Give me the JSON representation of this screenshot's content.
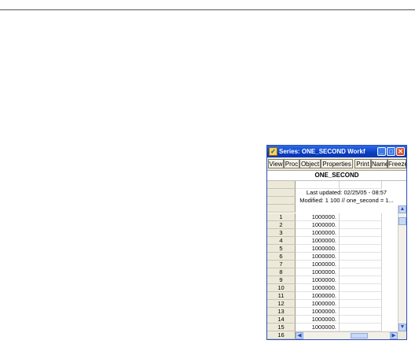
{
  "window": {
    "title": "Series: ONE_SECOND   Workfile: BA...",
    "icon": "series-icon",
    "minimize_glyph": "_",
    "maximize_glyph": "□",
    "close_glyph": "✕"
  },
  "toolbar": {
    "items": [
      "View",
      "Proc",
      "Object",
      "Properties",
      "Print",
      "Name",
      "Freeze"
    ]
  },
  "sheet": {
    "series_name": "ONE_SECOND",
    "last_updated": "Last updated: 02/25/05 - 08:57",
    "modified": "Modified: 1 100 // one_second = 1...",
    "rows": [
      {
        "n": "1",
        "v": "1000000."
      },
      {
        "n": "2",
        "v": "1000000."
      },
      {
        "n": "3",
        "v": "1000000."
      },
      {
        "n": "4",
        "v": "1000000."
      },
      {
        "n": "5",
        "v": "1000000."
      },
      {
        "n": "6",
        "v": "1000000."
      },
      {
        "n": "7",
        "v": "1000000."
      },
      {
        "n": "8",
        "v": "1000000."
      },
      {
        "n": "9",
        "v": "1000000."
      },
      {
        "n": "10",
        "v": "1000000."
      },
      {
        "n": "11",
        "v": "1000000."
      },
      {
        "n": "12",
        "v": "1000000."
      },
      {
        "n": "13",
        "v": "1000000."
      },
      {
        "n": "14",
        "v": "1000000."
      },
      {
        "n": "15",
        "v": "1000000."
      },
      {
        "n": "16",
        "v": ""
      }
    ]
  },
  "scroll": {
    "up": "▲",
    "down": "▼",
    "left": "◀",
    "right": "▶"
  }
}
